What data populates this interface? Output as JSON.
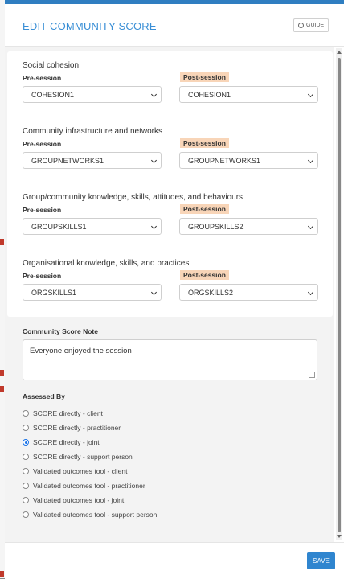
{
  "modal": {
    "title": "EDIT COMMUNITY SCORE",
    "guide_label": "GUIDE"
  },
  "pre_label": "Pre-session",
  "post_label": "Post-session",
  "sections": [
    {
      "title": "Social cohesion",
      "pre_value": "COHESION1",
      "post_value": "COHESION1"
    },
    {
      "title": "Community infrastructure and networks",
      "pre_value": "GROUPNETWORKS1",
      "post_value": "GROUPNETWORKS1"
    },
    {
      "title": "Group/community knowledge, skills, attitudes, and behaviours",
      "pre_value": "GROUPSKILLS1",
      "post_value": "GROUPSKILLS2"
    },
    {
      "title": "Organisational knowledge, skills, and practices",
      "pre_value": "ORGSKILLS1",
      "post_value": "ORGSKILLS2"
    }
  ],
  "note": {
    "label": "Community Score Note",
    "value": "Everyone enjoyed the session"
  },
  "assessed_by": {
    "label": "Assessed By",
    "options": [
      "SCORE directly - client",
      "SCORE directly - practitioner",
      "SCORE directly - joint",
      "SCORE directly - support person",
      "Validated outcomes tool - client",
      "Validated outcomes tool - practitioner",
      "Validated outcomes tool - joint",
      "Validated outcomes tool - support person"
    ],
    "selected": "SCORE directly - joint"
  },
  "footer": {
    "save_label": "SAVE"
  },
  "colors": {
    "accent": "#2f85cf",
    "post_highlight": "#f8d5b8",
    "title": "#3a8fd6"
  }
}
